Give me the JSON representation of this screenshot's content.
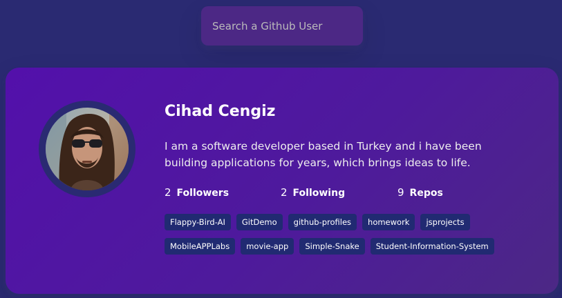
{
  "search": {
    "placeholder": "Search a Github User"
  },
  "profile": {
    "name": "Cihad Cengiz",
    "bio": "I am a software developer based in Turkey and i have been building applications for years, which brings ideas to life.",
    "avatar_icon": "user-avatar-photo",
    "stats": {
      "followers": {
        "count": "2",
        "label": "Followers"
      },
      "following": {
        "count": "2",
        "label": "Following"
      },
      "repos": {
        "count": "9",
        "label": "Repos"
      }
    },
    "repos": [
      "Flappy-Bird-AI",
      "GitDemo",
      "github-profiles",
      "homework",
      "jsprojects",
      "MobileAPPLabs",
      "movie-app",
      "Simple-Snake",
      "Student-Information-System"
    ]
  },
  "colors": {
    "background": "#2a2a72",
    "card": "#5310ab",
    "search": "#4c2885",
    "repo_tag": "#212a72",
    "text": "#ffffff"
  }
}
